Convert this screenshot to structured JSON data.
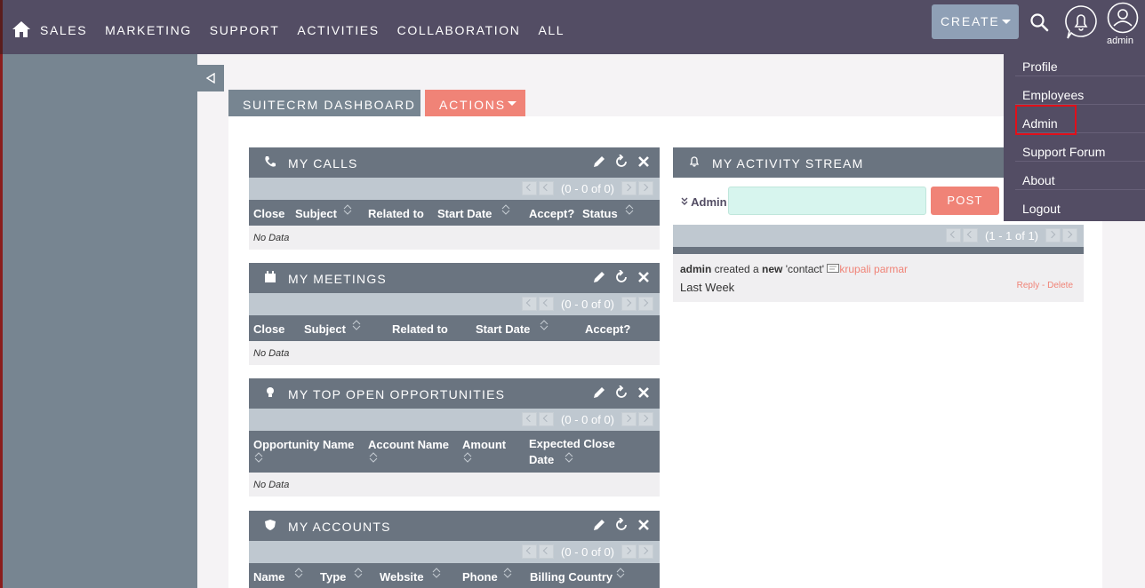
{
  "nav": {
    "items": [
      "SALES",
      "MARKETING",
      "SUPPORT",
      "ACTIVITIES",
      "COLLABORATION",
      "ALL"
    ],
    "create_label": "CREATE",
    "user_label": "admin"
  },
  "tabs": {
    "dashboard": "SUITECRM DASHBOARD",
    "actions": "ACTIONS"
  },
  "user_menu": [
    "Profile",
    "Employees",
    "Admin",
    "Support Forum",
    "About",
    "Logout"
  ],
  "dashlets": {
    "calls": {
      "title": "MY CALLS",
      "pager": "(0 - 0 of 0)",
      "columns": [
        "Close",
        "Subject",
        "Related to",
        "Start Date",
        "Accept?",
        "Status"
      ],
      "empty": "No Data"
    },
    "meetings": {
      "title": "MY MEETINGS",
      "pager": "(0 - 0 of 0)",
      "columns": [
        "Close",
        "Subject",
        "Related to",
        "Start Date",
        "Accept?"
      ],
      "empty": "No Data"
    },
    "opportunities": {
      "title": "MY TOP OPEN OPPORTUNITIES",
      "pager": "(0 - 0 of 0)",
      "columns": [
        "Opportunity Name",
        "Account Name",
        "Amount",
        "Expected Close Date"
      ],
      "empty": "No Data"
    },
    "accounts": {
      "title": "MY ACCOUNTS",
      "pager": "(0 - 0 of 0)",
      "columns": [
        "Name",
        "Type",
        "Website",
        "Phone",
        "Billing Country"
      ]
    }
  },
  "activity": {
    "title": "MY ACTIVITY STREAM",
    "user": "Admin",
    "post_label": "POST",
    "pager": "(1 - 1 of 1)",
    "entry": {
      "actor": "admin",
      "verb": " created a ",
      "new": "new",
      "object": " 'contact' ",
      "target": "krupali parmar",
      "when": "Last Week",
      "reply": "Reply",
      "sep": " - ",
      "delete": "Delete"
    }
  },
  "colors": {
    "nav_bg": "#534d64",
    "sidebar_bg": "#778591",
    "accent": "#f08377",
    "dashlet_header": "#6a7480",
    "highlight": "#e0101a"
  }
}
